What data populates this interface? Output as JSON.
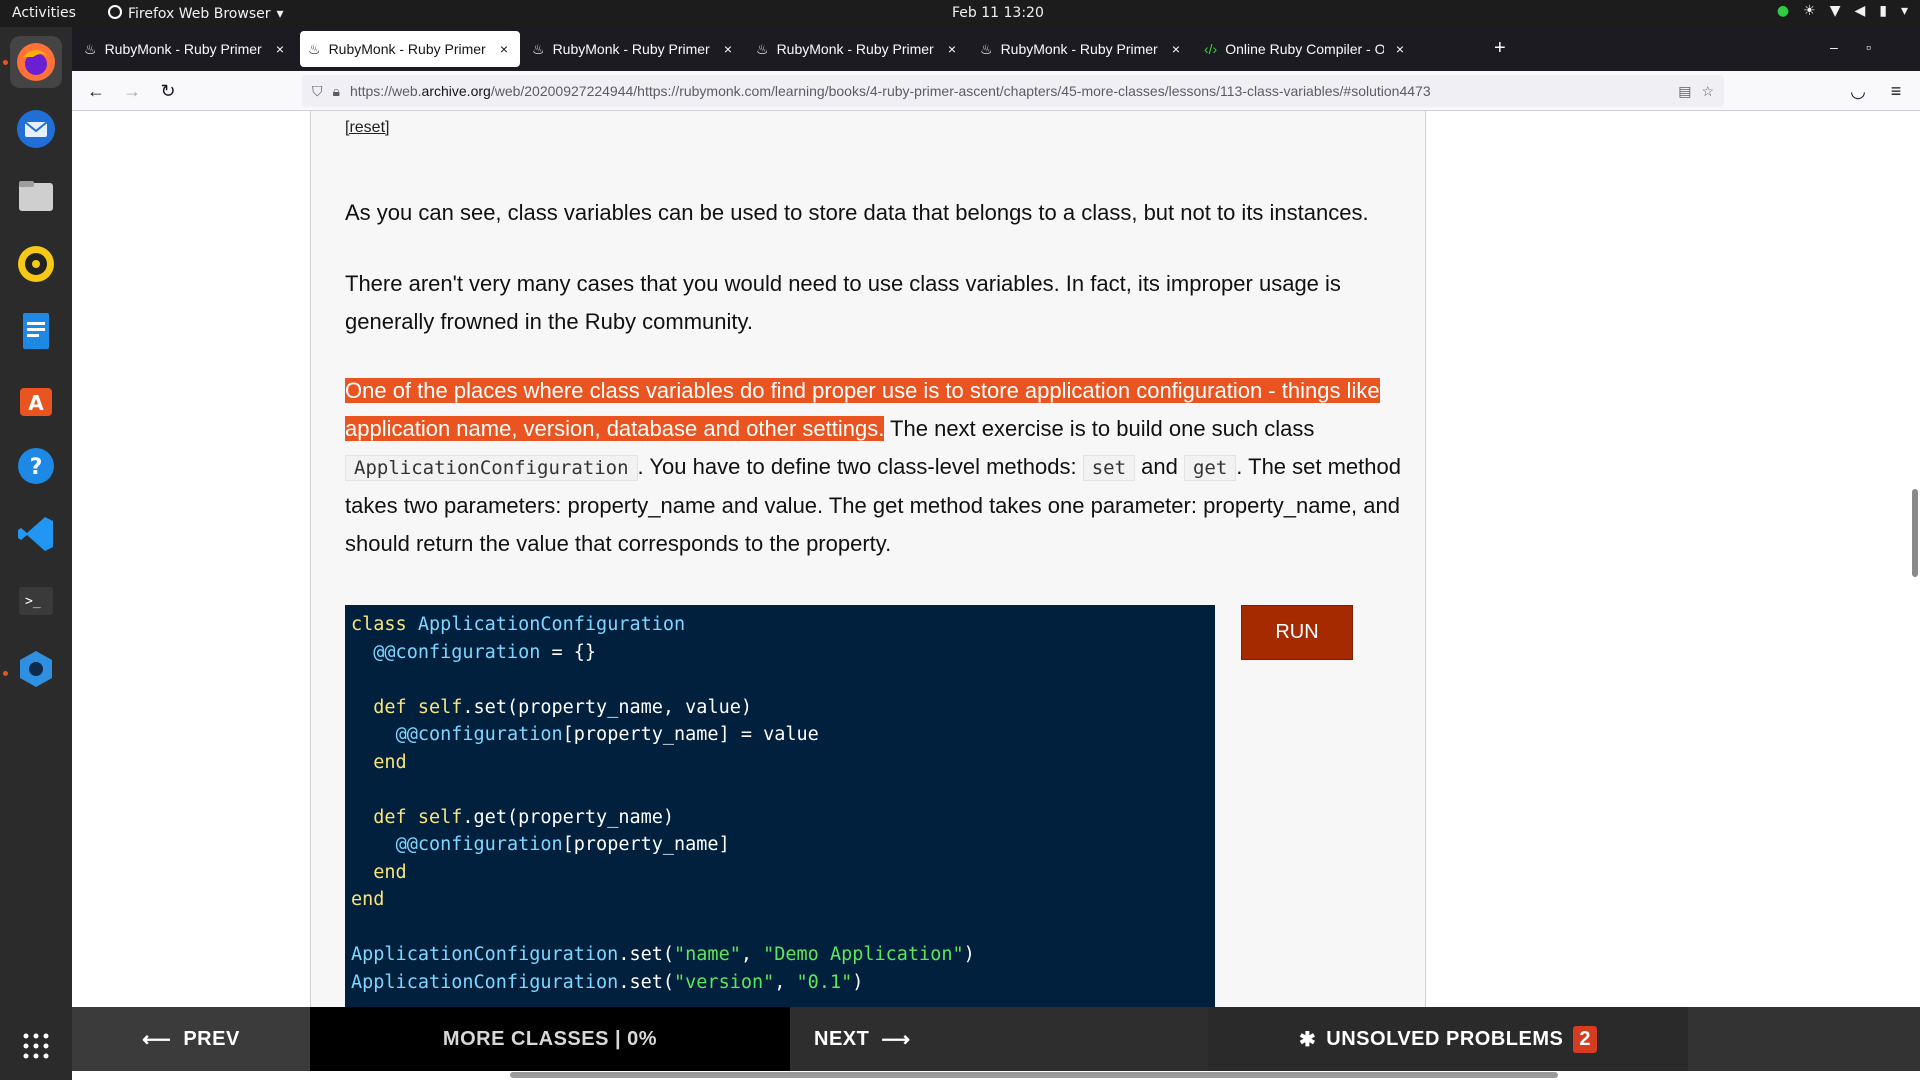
{
  "topbar": {
    "activities": "Activities",
    "app_name": "Firefox Web Browser",
    "clock": "Feb 11  13:20"
  },
  "browser": {
    "tabs": [
      {
        "title": "RubyMonk - Ruby Primer",
        "active": false
      },
      {
        "title": "RubyMonk - Ruby Primer",
        "active": true
      },
      {
        "title": "RubyMonk - Ruby Primer",
        "active": false
      },
      {
        "title": "RubyMonk - Ruby Primer",
        "active": false
      },
      {
        "title": "RubyMonk - Ruby Primer",
        "active": false
      },
      {
        "title": "Online Ruby Compiler - O",
        "active": false
      }
    ],
    "url_prefix": "https://web.",
    "url_domain": "archive.org",
    "url_rest": "/web/20200927224944/https://rubymonk.com/learning/books/4-ruby-primer-ascent/chapters/45-more-classes/lessons/113-class-variables/#solution4473"
  },
  "lesson": {
    "reset_label": "[reset]",
    "para1": "As you can see, class variables can be used to store data that belongs to a class, but not to its instances.",
    "para2": "There aren't very many cases that you would need to use class variables. In fact, its improper usage is generally frowned in the Ruby community.",
    "para3_highlight": "One of the places where class variables do find proper use is to store application configuration - things like application name, version, database and other settings.",
    "para3_a": " The next exercise is to build one such class ",
    "para3_code1": "ApplicationConfiguration",
    "para3_b": ". You have to define two class-level methods: ",
    "para3_code2": "set",
    "para3_c": " and ",
    "para3_code3": "get",
    "para3_d": ". The set method takes two parameters: property_name and value. The get method takes one parameter: property_name, and should return the value that corresponds to the property.",
    "run_label": "RUN"
  },
  "bottom_nav": {
    "prev_label": "PREV",
    "chapter_label": "MORE CLASSES | 0%",
    "next_label": "NEXT",
    "unsolved_label": "UNSOLVED PROBLEMS",
    "unsolved_count": "2"
  },
  "colors": {
    "highlight": "#e95420",
    "editor_bg": "#00203e",
    "run_button": "#a52a00"
  }
}
